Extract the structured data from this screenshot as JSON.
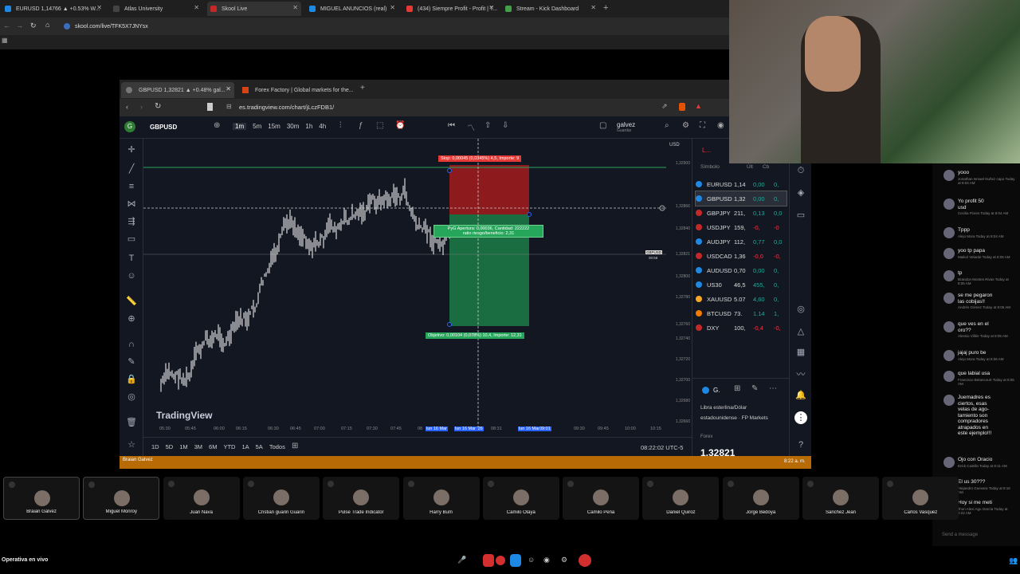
{
  "outer_tabs": [
    {
      "label": "EURUSD 1,14766 ▲ +0.53% W...",
      "color": "#1e88e5"
    },
    {
      "label": "Atlas University",
      "color": "#444"
    },
    {
      "label": "Skool Live",
      "color": "#c62828"
    },
    {
      "label": "MIGUEL ANUNCIOS (real)",
      "color": "#1e88e5"
    },
    {
      "label": "(434) Siempre Profit - Profit | T...",
      "color": "#e53935"
    },
    {
      "label": "Stream - Kick Dashboard",
      "color": "#43a047"
    }
  ],
  "outer_url": "skool.com/live/TFK5X7JNYsx",
  "inner_tabs": [
    {
      "label": "GBPUSD 1,32821 ▲ +0.48% gal..."
    },
    {
      "label": "Forex Factory | Global markets for the..."
    }
  ],
  "inner_url": "es.tradingview.com/chart/jLczFDB1/",
  "toolbar": {
    "symbol": "GBPUSD",
    "intervals": [
      "1m",
      "5m",
      "15m",
      "30m",
      "1h",
      "4h"
    ],
    "user": "galvez",
    "user_sub": "Guardar",
    "currency": "USD"
  },
  "chart_data": {
    "type": "candlestick",
    "symbol": "GBPUSD",
    "price_axis": [
      "1,32900",
      "1,32866",
      "1,32840",
      "1,32821",
      "1,32800",
      "1,32780",
      "1,32760",
      "1,32740",
      "1,32720",
      "1,32700",
      "1,32680",
      "1,32660"
    ],
    "time_axis": [
      "05:30",
      "05:45",
      "06:00",
      "06:15",
      "06:30",
      "06:45",
      "07:00",
      "07:15",
      "07:30",
      "07:45",
      "08",
      "lun 16 Mar",
      "lun 16 Mar '26",
      "08:31",
      "lun 16 Mar '26",
      "09:01",
      "09:30",
      "09:45",
      "10:00",
      "10:15"
    ],
    "current_price": "1,32821",
    "current_price_label": "GBPUSD",
    "current_time_label": "00:58",
    "stop_label": "Stop: 0,00045 (0,0345%) 4,5, Importe: 9",
    "pnl_label": "PyG Apertura: 0,00036, Cantidad: 222222",
    "ratio_label": "ratio riesgo/beneficio: 2,31",
    "target_label": "Objetivo: 0,00104 (0,078%) 10,4, Importe: 12,31",
    "watermark": "TradingView"
  },
  "range_buttons": [
    "1D",
    "5D",
    "1M",
    "3M",
    "6M",
    "YTD",
    "1A",
    "5A",
    "Todos"
  ],
  "clock": "08:22:02 UTC-5",
  "watchlist": {
    "header": "L...",
    "col_symbol": "Símbolo",
    "col_last": "Últ",
    "col_change": "Cb",
    "rows": [
      {
        "sym": "EURUSD",
        "last": "1,14",
        "chg": "0,00",
        "pct": "0,",
        "color": "#1e88e5"
      },
      {
        "sym": "GBPUSD",
        "last": "1,32",
        "chg": "0,00",
        "pct": "0,",
        "color": "#1e88e5"
      },
      {
        "sym": "GBPJPY",
        "last": "211,",
        "chg": "0,13",
        "pct": "0,0",
        "color": "#c62828"
      },
      {
        "sym": "USDJPY",
        "last": "159,",
        "chg": "-0,",
        "pct": "-0",
        "color": "#c62828"
      },
      {
        "sym": "AUDJPY",
        "last": "112,",
        "chg": "0,77",
        "pct": "0,0",
        "color": "#1e88e5"
      },
      {
        "sym": "USDCAD",
        "last": "1,36",
        "chg": "-0,0",
        "pct": "-0,",
        "color": "#c62828"
      },
      {
        "sym": "AUDUSD",
        "last": "0,70",
        "chg": "0,00",
        "pct": "0,",
        "color": "#1e88e5"
      },
      {
        "sym": "US30",
        "last": "46,5",
        "chg": "455,",
        "pct": "0,",
        "color": "#1e88e5"
      },
      {
        "sym": "XAUUSD",
        "last": "5.07",
        "chg": "4,60",
        "pct": "0,",
        "color": "#f9a825"
      },
      {
        "sym": "BTCUSD",
        "last": "73.",
        "chg": "1.14",
        "pct": "1,",
        "color": "#f57c00"
      },
      {
        "sym": "DXY",
        "last": "100,",
        "chg": "-0,4",
        "pct": "-0,",
        "color": "#c62828"
      }
    ],
    "detail_symbol": "G.",
    "detail_name": "Libra esterlina/Dólar estadounidense · FP Markets",
    "detail_type": "Forex",
    "detail_price": "1,32821"
  },
  "orange_bar": {
    "name": "Braian Galvez",
    "time": "8:22 a. m."
  },
  "chat": [
    {
      "text": "yooo",
      "meta": "Jonathan Ismael Nuñez capo Today at 8:04 AM"
    },
    {
      "text": "Yo profit 50\nusd",
      "meta": "Cecilia Flores Today at 8:04 AM"
    },
    {
      "text": "Tppp",
      "meta": "Alejo Mora Today at 8:04 AM"
    },
    {
      "text": "yoo tp papa",
      "meta": "Maikol Velarde Today at 8:05 AM"
    },
    {
      "text": "tp",
      "meta": "Brandon Montes Rivas Today at 8:05 AM"
    },
    {
      "text": "se me pegaron\nlas cobijas!!",
      "meta": "Andrés Gómez Today at 8:05 AM"
    },
    {
      "text": "que ves en el\noro??",
      "meta": "Alessio Villée Today at 8:05 AM"
    },
    {
      "text": "jajaj puro be",
      "meta": "Alejo Mora Today at 8:06 AM"
    },
    {
      "text": "que labial usa",
      "meta": "Francisco Betancourt Today at 8:06 AM"
    },
    {
      "text": "Juemadres es\nciertos, esas\nvelas de ago-\ntamiento son\ncompradores\natrapados en\neste ejemplo!!!",
      "meta": ""
    },
    {
      "text": "Ojo con Oracio",
      "meta": "Erick Castillo Today at 8:11 AM"
    },
    {
      "text": "El us 30???",
      "meta": "Alejandro Guevara Today at 8:16 AM"
    },
    {
      "text": "Hoy si me meti",
      "meta": "Jhon Alexi Agu García Today at 8:22 AM"
    }
  ],
  "chat_placeholder": "Send a message",
  "participants": [
    "Braian Galvez",
    "Miguel Monroy",
    "Juan Nava",
    "Cristian guarin Guarin",
    "Pulse Trade Indicator",
    "Harry Bum",
    "Camilo Olaya",
    "Camilo Peña",
    "Daniel Quiroz",
    "Jorge Bedoya",
    "Sanchez Jean",
    "Carlos Vasquez"
  ],
  "bottom_label": "Operativa en vivo",
  "colors": {
    "up": "#ffffff",
    "down": "#ffffff",
    "stop": "#c62828",
    "target": "#26a65b",
    "accent": "#2962ff",
    "orange": "#b86a05"
  }
}
